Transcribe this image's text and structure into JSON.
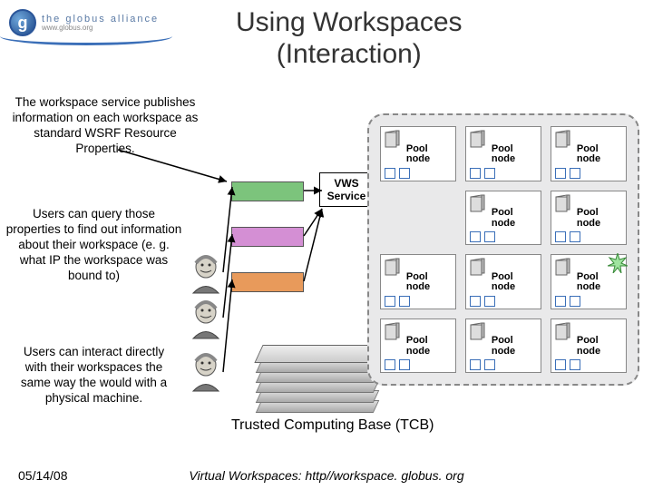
{
  "logo": {
    "line1": "the globus alliance",
    "line2": "www.globus.org",
    "glyph": "g"
  },
  "title": "Using Workspaces\n(Interaction)",
  "descriptions": {
    "d1": "The workspace service publishes information on each workspace as standard WSRF Resource Properties.",
    "d2": "Users can query those properties to find out information about their workspace (e. g. what IP the workspace was bound to)",
    "d3": "Users can interact directly with their workspaces the same way the would with a physical machine."
  },
  "vws_label": "VWS Service",
  "pool": {
    "node_label": "Pool node",
    "rows": 4,
    "cols": 3,
    "starburst_cells": [
      8
    ],
    "empty_cells": [
      3
    ]
  },
  "color_boxes": [
    "#7cc47c",
    "#d48fd4",
    "#e89a5b"
  ],
  "tcb_label": "Trusted Computing Base (TCB)",
  "footer": {
    "date": "05/14/08",
    "credit": "Virtual Workspaces: http//workspace. globus. org"
  }
}
